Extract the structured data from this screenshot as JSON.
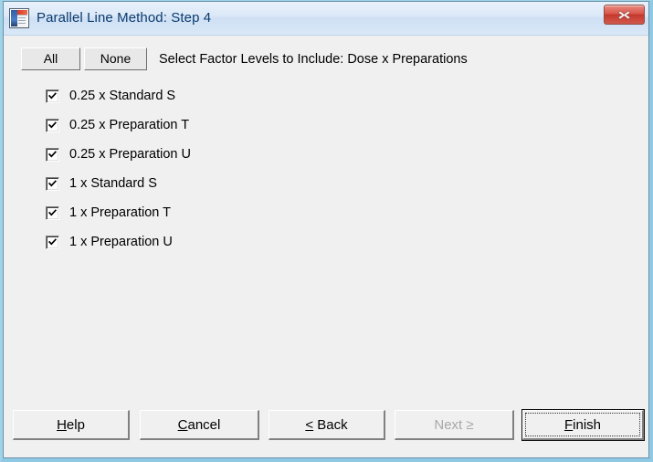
{
  "window": {
    "title": "Parallel Line Method: Step 4",
    "icon": "application-document-icon",
    "close_label": "Close",
    "accent_color": "#c5382c",
    "titlebar_color": "#d9e8f8",
    "body_color": "#f0f0f0"
  },
  "toolbar": {
    "all_label": "All",
    "none_label": "None",
    "instruction": "Select Factor Levels to Include: Dose x Preparations"
  },
  "checklist": {
    "items": [
      {
        "label": "0.25 x Standard S",
        "checked": true
      },
      {
        "label": "0.25 x Preparation T",
        "checked": true
      },
      {
        "label": "0.25 x Preparation U",
        "checked": true
      },
      {
        "label": "1 x Standard S",
        "checked": true
      },
      {
        "label": "1 x Preparation T",
        "checked": true
      },
      {
        "label": "1 x Preparation U",
        "checked": true
      }
    ]
  },
  "buttons": {
    "help": {
      "accel": "H",
      "rest": "elp",
      "disabled": false
    },
    "cancel": {
      "accel": "C",
      "rest": "ancel",
      "disabled": false
    },
    "back": {
      "pre": "",
      "accel": "<",
      "rest": " Back",
      "disabled": false
    },
    "next": {
      "label": "Next ≥",
      "disabled": true
    },
    "finish": {
      "accel": "F",
      "rest": "inish",
      "disabled": false,
      "is_default": true
    }
  }
}
